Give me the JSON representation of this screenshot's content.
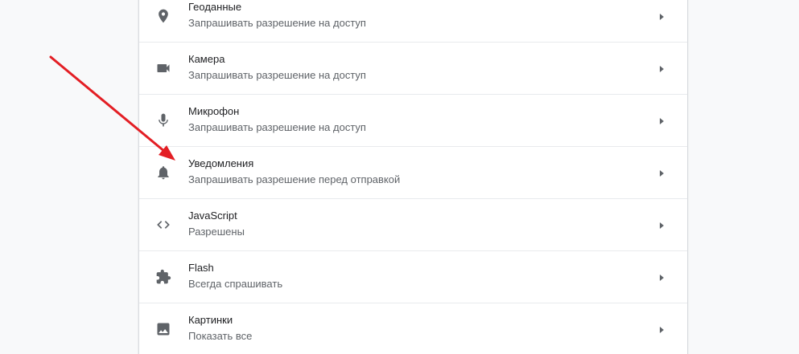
{
  "settings": {
    "items": [
      {
        "title": "Геоданные",
        "subtitle": "Запрашивать разрешение на доступ",
        "icon": "location-pin-icon"
      },
      {
        "title": "Камера",
        "subtitle": "Запрашивать разрешение на доступ",
        "icon": "camera-icon"
      },
      {
        "title": "Микрофон",
        "subtitle": "Запрашивать разрешение на доступ",
        "icon": "microphone-icon"
      },
      {
        "title": "Уведомления",
        "subtitle": "Запрашивать разрешение перед отправкой",
        "icon": "bell-icon"
      },
      {
        "title": "JavaScript",
        "subtitle": "Разрешены",
        "icon": "code-icon"
      },
      {
        "title": "Flash",
        "subtitle": "Всегда спрашивать",
        "icon": "puzzle-icon"
      },
      {
        "title": "Картинки",
        "subtitle": "Показать все",
        "icon": "image-icon"
      }
    ]
  },
  "colors": {
    "icon": "#5f6368",
    "annotation_arrow": "#e31e24"
  }
}
